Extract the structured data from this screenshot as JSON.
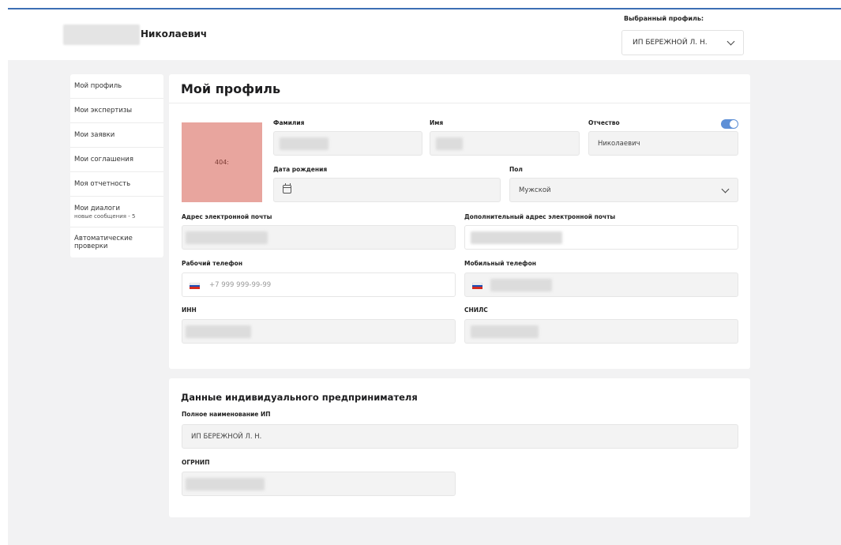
{
  "header": {
    "user_name": "Николаевич",
    "profile_label": "Выбранный профиль:",
    "profile_value": "ИП БЕРЕЖНОЙ Л. Н."
  },
  "sidebar": {
    "items": [
      {
        "label": "Мой профиль"
      },
      {
        "label": "Мои экспертизы"
      },
      {
        "label": "Мои заявки"
      },
      {
        "label": "Мои соглашения"
      },
      {
        "label": "Моя отчетность"
      },
      {
        "label": "Мои диалоги",
        "sub": "новые сообщения - 5"
      },
      {
        "label": "Автоматические проверки"
      }
    ]
  },
  "profile": {
    "title": "Мой профиль",
    "photo_text": "404:",
    "labels": {
      "surname": "Фамилия",
      "name": "Имя",
      "patronymic": "Отчество",
      "birthdate": "Дата рождения",
      "gender": "Пол",
      "email": "Адрес электронной почты",
      "email_extra": "Дополнительный адрес электронной почты",
      "work_phone": "Рабочий телефон",
      "mobile_phone": "Мобильный телефон",
      "inn": "ИНН",
      "snils": "СНИЛС"
    },
    "values": {
      "patronymic": "Николаевич",
      "gender": "Мужской",
      "work_phone_placeholder": "+7 999 999-99-99"
    }
  },
  "entrepreneur": {
    "title": "Данные индивидуального предпринимателя",
    "full_name_label": "Полное наименование ИП",
    "full_name_value": "ИП БЕРЕЖНОЙ Л. Н.",
    "ogrnip_label": "ОГРНИП"
  },
  "colors": {
    "accent": "#3d6fb4",
    "photo_placeholder": "#e8a59e",
    "toggle": "#5d8fd6",
    "page_bg": "#f2f2f3"
  }
}
